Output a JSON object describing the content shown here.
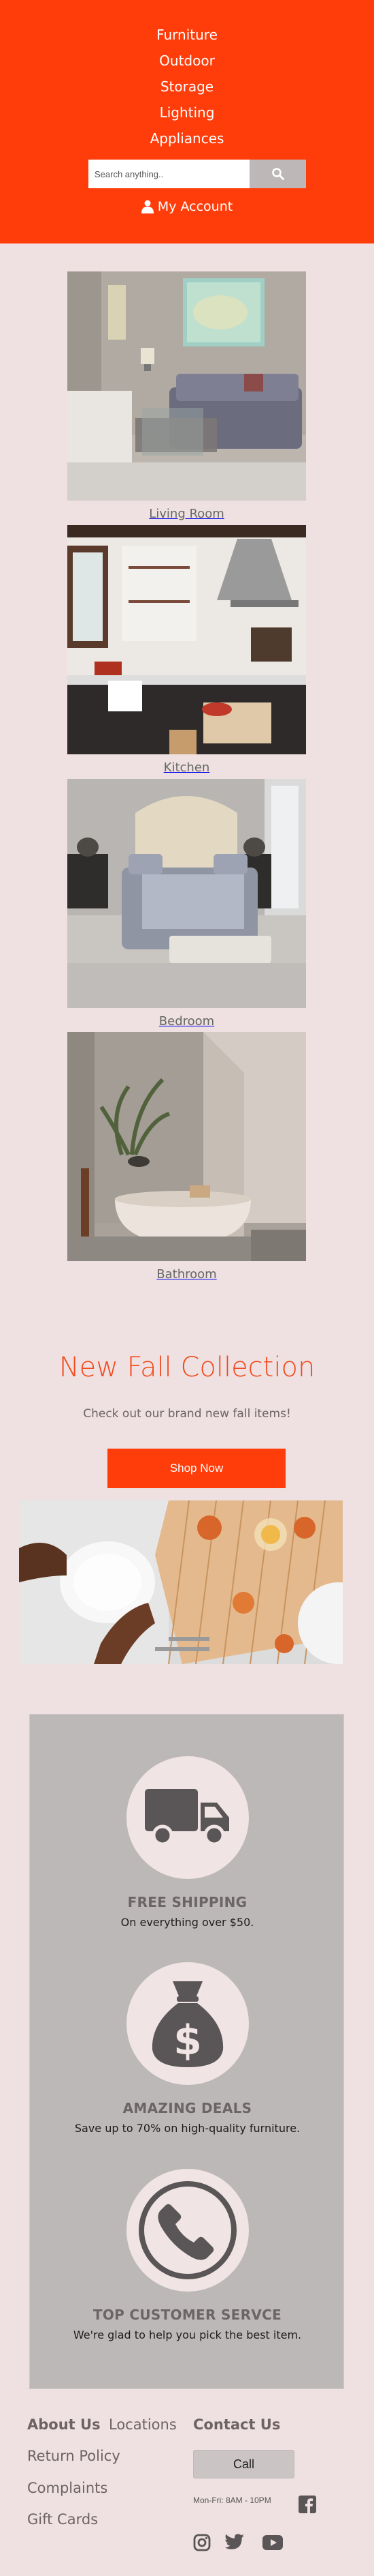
{
  "header": {
    "nav": [
      "Furniture",
      "Outdoor",
      "Storage",
      "Lighting",
      "Appliances"
    ],
    "search_placeholder": "Search anything..",
    "account_label": "My Account",
    "background_color": "#ff3d0b"
  },
  "rooms": [
    {
      "label": "Living Room"
    },
    {
      "label": "Kitchen"
    },
    {
      "label": "Bedroom"
    },
    {
      "label": "Bathroom"
    }
  ],
  "promo": {
    "title": "New Fall Collection",
    "subtitle": "Check out our brand new fall items!",
    "button": "Shop Now"
  },
  "features": [
    {
      "icon": "truck-icon",
      "title": "FREE SHIPPING",
      "text": "On everything over $50."
    },
    {
      "icon": "money-bag-icon",
      "title": "AMAZING DEALS",
      "text": "Save up to 70% on high-quality furniture."
    },
    {
      "icon": "phone-icon",
      "title": "TOP CUSTOMER SERVCE",
      "text": "We're glad to help you pick the best item."
    }
  ],
  "footer": {
    "about": "About Us",
    "locations": "Locations",
    "contact": "Contact Us",
    "return_policy": "Return Policy",
    "complaints": "Complaints",
    "gift_cards": "Gift Cards",
    "call": "Call",
    "hours": "Mon-Fri: 8AM - 10PM",
    "social": [
      "facebook-icon",
      "instagram-icon",
      "twitter-icon",
      "youtube-icon"
    ]
  },
  "colors": {
    "accent": "#ff3d0b",
    "page_background": "#efe1e1",
    "panel": "#bdb8b8"
  }
}
